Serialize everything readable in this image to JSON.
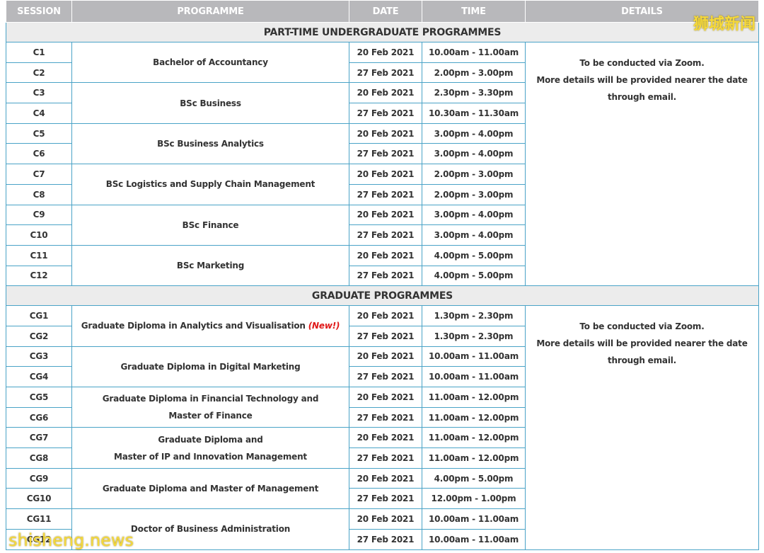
{
  "headers": [
    "SESSION",
    "PROGRAMME",
    "DATE",
    "TIME",
    "DETAILS"
  ],
  "sections": [
    {
      "title": "PART-TIME UNDERGRADUATE PROGRAMMES",
      "details": [
        "To be conducted via Zoom.",
        "More details will be provided nearer the date",
        "through email."
      ],
      "programmes": [
        {
          "name": [
            "Bachelor of Accountancy"
          ],
          "sessions": [
            {
              "id": "C1",
              "date": "20 Feb 2021",
              "time": "10.00am - 11.00am"
            },
            {
              "id": "C2",
              "date": "27 Feb 2021",
              "time": "2.00pm - 3.00pm"
            }
          ]
        },
        {
          "name": [
            "BSc Business"
          ],
          "sessions": [
            {
              "id": "C3",
              "date": "20 Feb 2021",
              "time": "2.30pm - 3.30pm"
            },
            {
              "id": "C4",
              "date": "27 Feb 2021",
              "time": "10.30am - 11.30am"
            }
          ]
        },
        {
          "name": [
            "BSc Business Analytics"
          ],
          "sessions": [
            {
              "id": "C5",
              "date": "20 Feb 2021",
              "time": "3.00pm - 4.00pm"
            },
            {
              "id": "C6",
              "date": "27 Feb 2021",
              "time": "3.00pm - 4.00pm"
            }
          ]
        },
        {
          "name": [
            "BSc Logistics and Supply Chain Management"
          ],
          "sessions": [
            {
              "id": "C7",
              "date": "20 Feb 2021",
              "time": "2.00pm - 3.00pm"
            },
            {
              "id": "C8",
              "date": "27 Feb 2021",
              "time": "2.00pm - 3.00pm"
            }
          ]
        },
        {
          "name": [
            "BSc Finance"
          ],
          "sessions": [
            {
              "id": "C9",
              "date": "20 Feb 2021",
              "time": "3.00pm - 4.00pm"
            },
            {
              "id": "C10",
              "date": "27 Feb 2021",
              "time": "3.00pm - 4.00pm"
            }
          ]
        },
        {
          "name": [
            "BSc Marketing"
          ],
          "sessions": [
            {
              "id": "C11",
              "date": "20 Feb 2021",
              "time": "4.00pm - 5.00pm"
            },
            {
              "id": "C12",
              "date": "27 Feb 2021",
              "time": "4.00pm - 5.00pm"
            }
          ]
        }
      ]
    },
    {
      "title": "GRADUATE PROGRAMMES",
      "details": [
        "To be conducted via Zoom.",
        "More details will be provided nearer the date",
        "through email."
      ],
      "programmes": [
        {
          "name": [
            "Graduate Diploma in Analytics and Visualisation"
          ],
          "tag": "(New!)",
          "sessions": [
            {
              "id": "CG1",
              "date": "20 Feb 2021",
              "time": "1.30pm - 2.30pm"
            },
            {
              "id": "CG2",
              "date": "27 Feb 2021",
              "time": "1.30pm - 2.30pm"
            }
          ]
        },
        {
          "name": [
            "Graduate Diploma in Digital Marketing"
          ],
          "sessions": [
            {
              "id": "CG3",
              "date": "20 Feb 2021",
              "time": "10.00am - 11.00am"
            },
            {
              "id": "CG4",
              "date": "27 Feb 2021",
              "time": "10.00am - 11.00am"
            }
          ]
        },
        {
          "name": [
            "Graduate Diploma in Financial Technology and",
            "Master of Finance"
          ],
          "sessions": [
            {
              "id": "CG5",
              "date": "20 Feb 2021",
              "time": "11.00am - 12.00pm"
            },
            {
              "id": "CG6",
              "date": "27 Feb 2021",
              "time": "11.00am - 12.00pm"
            }
          ]
        },
        {
          "name": [
            "Graduate Diploma and",
            "Master of IP and Innovation Management"
          ],
          "sessions": [
            {
              "id": "CG7",
              "date": "20 Feb 2021",
              "time": "11.00am - 12.00pm"
            },
            {
              "id": "CG8",
              "date": "27 Feb 2021",
              "time": "11.00am - 12.00pm"
            }
          ]
        },
        {
          "name": [
            "Graduate Diploma and Master of Management"
          ],
          "sessions": [
            {
              "id": "CG9",
              "date": "20 Feb 2021",
              "time": "4.00pm - 5.00pm"
            },
            {
              "id": "CG10",
              "date": "27 Feb 2021",
              "time": "12.00pm - 1.00pm"
            }
          ]
        },
        {
          "name": [
            "Doctor of Business Administration"
          ],
          "sessions": [
            {
              "id": "CG11",
              "date": "20 Feb 2021",
              "time": "10.00am - 11.00am"
            },
            {
              "id": "CG12",
              "date": "27 Feb 2021",
              "time": "10.00am - 11.00am"
            }
          ]
        }
      ]
    }
  ],
  "watermarks": {
    "top": "狮城新闻",
    "bottom": "shisheng.news"
  }
}
